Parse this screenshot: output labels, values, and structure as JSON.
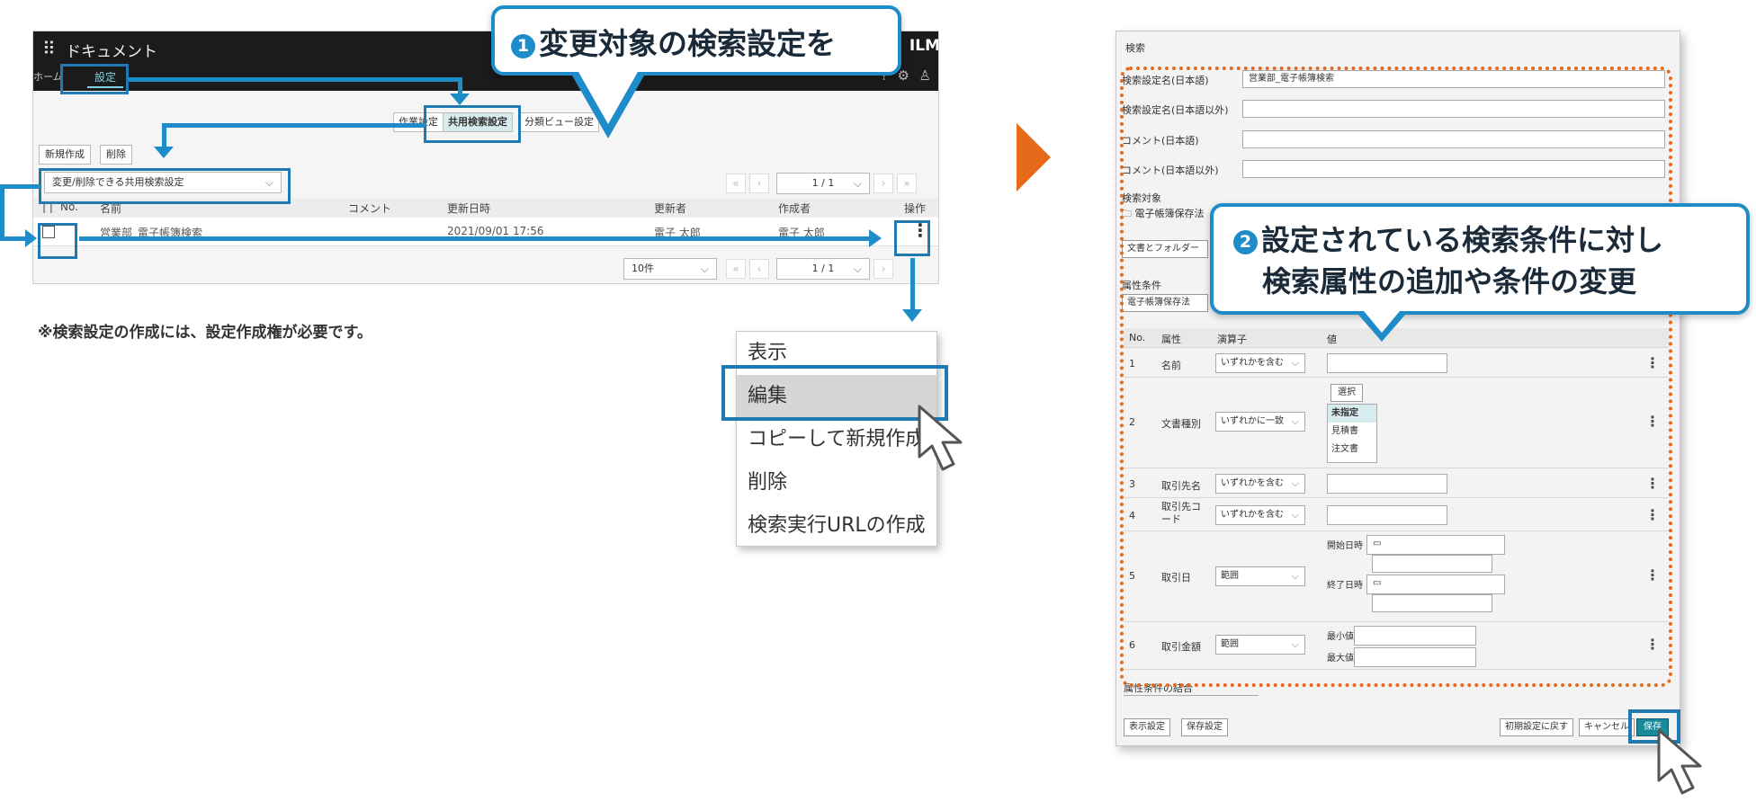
{
  "left_window": {
    "app_title": "ドキュメント",
    "brand": "ILM",
    "home_label": "ホーム",
    "settings_tab": "設定",
    "subtabs": [
      "作業設定",
      "共用検索設定",
      "分類ビュー設定"
    ],
    "new_button": "新規作成",
    "delete_button": "削除",
    "search_select": "変更/削除できる共用検索設定",
    "page_indicator": "1 / 1",
    "per_page": "10件",
    "columns": [
      "No.",
      "名前",
      "コメント",
      "更新日時",
      "更新者",
      "作成者",
      "操作"
    ],
    "row": {
      "name": "営業部_電子帳簿検索",
      "updated": "2021/09/01 17:56",
      "updater": "電子 太郎",
      "creator": "電子 太郎"
    }
  },
  "callout1": {
    "number": "1",
    "text": "変更対象の検索設定を"
  },
  "note": "※検索設定の作成には、設定作成権が必要です。",
  "context_menu": {
    "items": [
      "表示",
      "編集",
      "コピーして新規作成",
      "削除",
      "検索実行URLの作成"
    ],
    "selected_index": 1
  },
  "callout2": {
    "number": "2",
    "line1": "設定されている検索条件に対し",
    "line2": "検索属性の追加や条件の変更"
  },
  "right_window": {
    "title": "検索",
    "fields": [
      {
        "label": "検索設定名(日本語)",
        "value": "営業部_電子帳簿検索"
      },
      {
        "label": "検索設定名(日本語以外)",
        "value": ""
      },
      {
        "label": "コメント(日本語)",
        "value": ""
      },
      {
        "label": "コメント(日本語以外)",
        "value": ""
      }
    ],
    "target_label": "検索対象",
    "target_value": "電子帳簿保存法",
    "doc_folder_button": "文書とフォルダー",
    "attr_cond_label": "属性条件",
    "attr_cond_value": "電子帳簿保存法",
    "table_headers": [
      "No.",
      "属性",
      "演算子",
      "値"
    ],
    "rows": [
      {
        "no": "1",
        "attr": "名前",
        "op": "いずれかを含む"
      },
      {
        "no": "2",
        "attr": "文書種別",
        "op": "いずれかに一致",
        "select_button": "選択",
        "list": [
          "未指定",
          "見積書",
          "注文書"
        ]
      },
      {
        "no": "3",
        "attr": "取引先名",
        "op": "いずれかを含む"
      },
      {
        "no": "4",
        "attr": "取引先コード",
        "op": "いずれかを含む"
      },
      {
        "no": "5",
        "attr": "取引日",
        "op": "範囲",
        "start_label": "開始日時",
        "end_label": "終了日時"
      },
      {
        "no": "6",
        "attr": "取引金額",
        "op": "範囲",
        "min_label": "最小値",
        "max_label": "最大値"
      }
    ],
    "combine_label": "属性条件の結合",
    "footer_left": [
      "表示設定",
      "保存設定"
    ],
    "footer_right": [
      "初期設定に戻す",
      "キャンセル",
      "保存"
    ]
  }
}
